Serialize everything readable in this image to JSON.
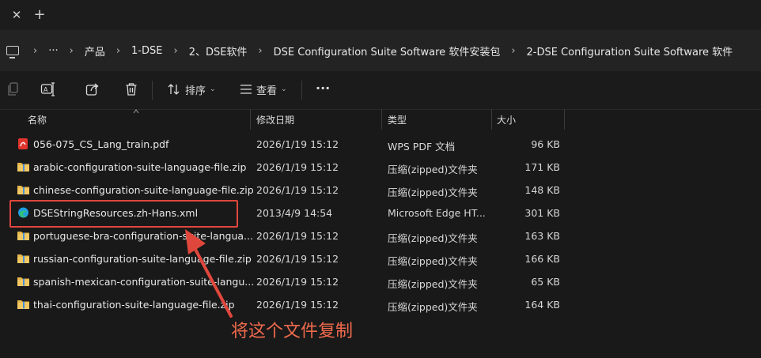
{
  "window": {
    "add_tab_label": "+"
  },
  "breadcrumb": {
    "items": [
      "产品",
      "1-DSE",
      "2、DSE软件",
      "DSE Configuration Suite Software 软件安装包",
      "2-DSE Configuration Suite Software 软件"
    ],
    "more_label": "···",
    "separator": "›"
  },
  "toolbar": {
    "sort_label": "排序",
    "view_label": "查看",
    "more_label": "···"
  },
  "columns": {
    "name": "名称",
    "date": "修改日期",
    "type": "类型",
    "size": "大小"
  },
  "files": [
    {
      "name": "056-075_CS_Lang_train.pdf",
      "date": "2026/1/19 15:12",
      "type": "WPS PDF 文档",
      "size": "96 KB",
      "icon": "pdf-icon"
    },
    {
      "name": "arabic-configuration-suite-language-file.zip",
      "date": "2026/1/19 15:12",
      "type": "压缩(zipped)文件夹",
      "size": "171 KB",
      "icon": "zip-folder-icon"
    },
    {
      "name": "chinese-configuration-suite-language-file.zip",
      "date": "2026/1/19 15:12",
      "type": "压缩(zipped)文件夹",
      "size": "148 KB",
      "icon": "zip-folder-icon"
    },
    {
      "name": "DSEStringResources.zh-Hans.xml",
      "date": "2013/4/9 14:54",
      "type": "Microsoft Edge HT...",
      "size": "301 KB",
      "icon": "edge-icon"
    },
    {
      "name": "portuguese-bra-configuration-suite-langua...",
      "date": "2026/1/19 15:12",
      "type": "压缩(zipped)文件夹",
      "size": "163 KB",
      "icon": "zip-folder-icon"
    },
    {
      "name": "russian-configuration-suite-language-file.zip",
      "date": "2026/1/19 15:12",
      "type": "压缩(zipped)文件夹",
      "size": "166 KB",
      "icon": "zip-folder-icon"
    },
    {
      "name": "spanish-mexican-configuration-suite-langu...",
      "date": "2026/1/19 15:12",
      "type": "压缩(zipped)文件夹",
      "size": "65 KB",
      "icon": "zip-folder-icon"
    },
    {
      "name": "thai-configuration-suite-language-file.zip",
      "date": "2026/1/19 15:12",
      "type": "压缩(zipped)文件夹",
      "size": "164 KB",
      "icon": "zip-folder-icon"
    }
  ],
  "annotation": {
    "text": "将这个文件复制",
    "color": "#f06a4d",
    "highlight_color": "#e0473c"
  }
}
